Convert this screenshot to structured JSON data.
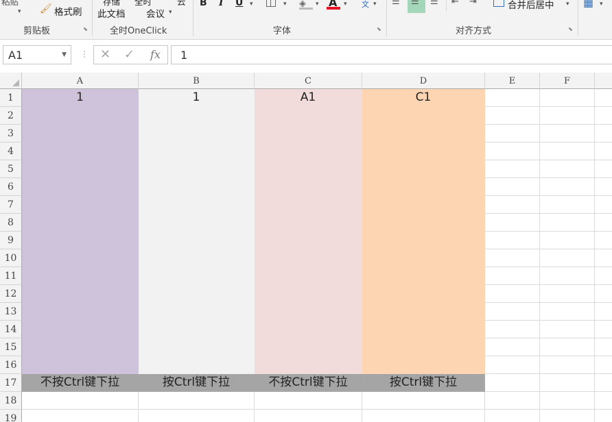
{
  "ribbon": {
    "paste_label": "粘贴",
    "format_painter": "格式刷",
    "save_doc": "此文档",
    "save_doc_top": "存储",
    "meeting": "会议",
    "meeting_top_left": "全时",
    "meeting_top_right": "云",
    "bold": "B",
    "italic": "I",
    "underline": "U",
    "font_color": "A",
    "phonetic": "文",
    "merge_center": "合并后居中",
    "groups": {
      "clipboard": "剪贴板",
      "oneclick": "全时OneClick",
      "font": "字体",
      "alignment": "对齐方式"
    },
    "colors": {
      "font_color_bar": "#e81123",
      "highlight_align": "#a4d7b9"
    }
  },
  "formula_bar": {
    "name_box": "A1",
    "cancel_icon": "cancel-icon",
    "enter_icon": "check-icon",
    "fx_label": "fx",
    "value": "1"
  },
  "sheet": {
    "columns": [
      "A",
      "B",
      "C",
      "D",
      "E",
      "F"
    ],
    "rows": [
      "1",
      "2",
      "3",
      "4",
      "5",
      "6",
      "7",
      "8",
      "9",
      "10",
      "11",
      "12",
      "13",
      "14",
      "15",
      "16",
      "17",
      "18",
      "19"
    ],
    "row1": [
      "1",
      "1",
      "A1",
      "C1"
    ],
    "row17": [
      "不按Ctrl键下拉",
      "按Ctrl键下拉",
      "不按Ctrl键下拉",
      "按Ctrl键下拉"
    ],
    "fill_colors": {
      "A": "#cfc3db",
      "B": "#f2f2f2",
      "C": "#f1dcdb",
      "D": "#fdd5b2",
      "row17": "#a6a6a6"
    }
  }
}
